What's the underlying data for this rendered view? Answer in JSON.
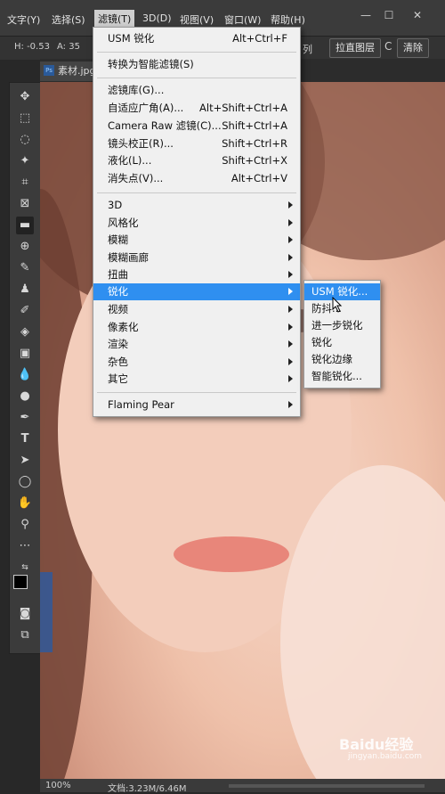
{
  "menubar": {
    "items": [
      {
        "label": "文字(Y)"
      },
      {
        "label": "选择(S)"
      },
      {
        "label": "滤镜(T)"
      },
      {
        "label": "3D(D)"
      },
      {
        "label": "视图(V)"
      },
      {
        "label": "窗口(W)"
      },
      {
        "label": "帮助(H)"
      }
    ],
    "window_buttons": {
      "minimize": "—",
      "restore": "☐",
      "close": "✕"
    }
  },
  "options_bar": {
    "h_value": "H: -0.53",
    "a_value": "A: 35",
    "col_suffix": "列",
    "straighten_button": "拉直图层",
    "c_label": "C",
    "clear_button": "清除"
  },
  "document": {
    "tab_name": "素材.jpg",
    "zoom": "100%",
    "doc_info": "文档:3.23M/6.46M"
  },
  "filter_menu": {
    "usm": {
      "label": "USM 锐化",
      "shortcut": "Alt+Ctrl+F"
    },
    "smart": {
      "label": "转换为智能滤镜(S)"
    },
    "gallery": {
      "label": "滤镜库(G)..."
    },
    "adaptive": {
      "label": "自适应广角(A)...",
      "shortcut": "Alt+Shift+Ctrl+A"
    },
    "camera_raw": {
      "label": "Camera Raw 滤镜(C)...",
      "shortcut": "Shift+Ctrl+A"
    },
    "lens": {
      "label": "镜头校正(R)...",
      "shortcut": "Shift+Ctrl+R"
    },
    "liquify": {
      "label": "液化(L)...",
      "shortcut": "Shift+Ctrl+X"
    },
    "vanish": {
      "label": "消失点(V)...",
      "shortcut": "Alt+Ctrl+V"
    },
    "three_d": {
      "label": "3D"
    },
    "stylize": {
      "label": "风格化"
    },
    "blur": {
      "label": "模糊"
    },
    "blur_gallery": {
      "label": "模糊画廊"
    },
    "distort": {
      "label": "扭曲"
    },
    "sharpen": {
      "label": "锐化"
    },
    "video": {
      "label": "视频"
    },
    "pixelate": {
      "label": "像素化"
    },
    "render": {
      "label": "渲染"
    },
    "noise": {
      "label": "杂色"
    },
    "other": {
      "label": "其它"
    },
    "flaming_pear": {
      "label": "Flaming Pear"
    }
  },
  "sharpen_submenu": {
    "usm": "USM 锐化...",
    "shake": "防抖...",
    "further": "进一步锐化",
    "sharpen": "锐化",
    "edges": "锐化边缘",
    "smart": "智能锐化..."
  },
  "watermark": {
    "text": "Baidu经验",
    "url": "jingyan.baidu.com"
  },
  "colors": {
    "highlight": "#2f8ff0",
    "menu_bg": "#f0f0f0",
    "app_bg": "#3b3b3b"
  }
}
